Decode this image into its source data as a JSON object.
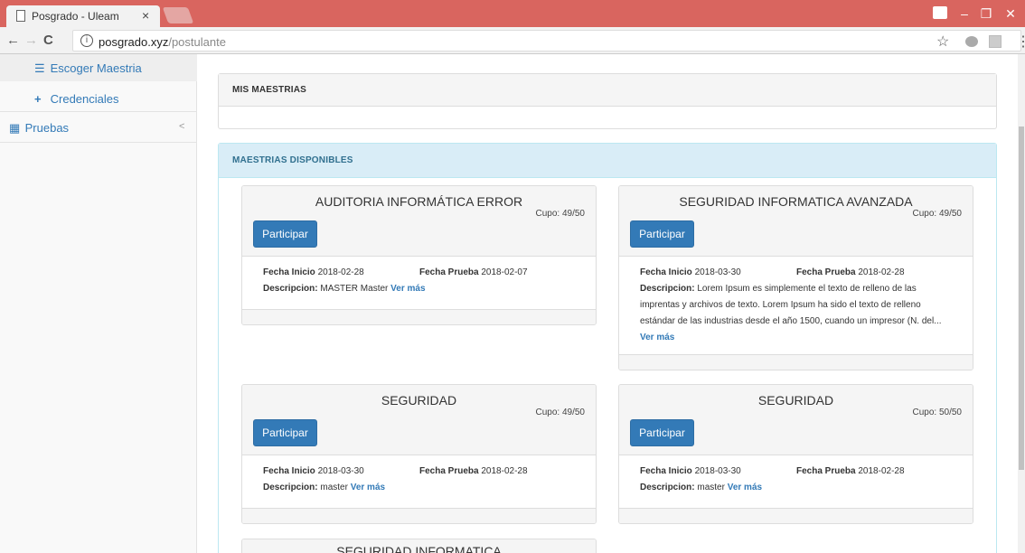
{
  "browser": {
    "tab_title": "Posgrado - Uleam",
    "tab_close": "×",
    "url_host": "posgrado.xyz",
    "url_path": "/postulante"
  },
  "sidebar": {
    "items": [
      {
        "label": "Escoger Maestria",
        "icon": "list-icon"
      },
      {
        "label": "Credenciales",
        "icon": "plus-icon"
      },
      {
        "label": "Pruebas",
        "icon": "film-icon"
      }
    ]
  },
  "mis_maestrias": {
    "heading": "MIS MAESTRIAS"
  },
  "disponibles": {
    "heading": "MAESTRIAS DISPONIBLES",
    "labels": {
      "cupo": "Cupo:",
      "participar": "Participar",
      "fecha_inicio": "Fecha Inicio",
      "fecha_prueba": "Fecha Prueba",
      "descripcion": "Descripcion:",
      "ver_mas": "Ver más"
    },
    "cards": [
      {
        "title": "AUDITORIA INFORMÁTICA ERROR",
        "cupo": "49/50",
        "fecha_inicio": "2018-02-28",
        "fecha_prueba": "2018-02-07",
        "descripcion": "MASTER Master"
      },
      {
        "title": "SEGURIDAD INFORMATICA AVANZADA",
        "cupo": "49/50",
        "fecha_inicio": "2018-03-30",
        "fecha_prueba": "2018-02-28",
        "descripcion": "Lorem Ipsum es simplemente el texto de relleno de las imprentas y archivos de texto. Lorem Ipsum ha sido el texto de relleno estándar de las industrias desde el año 1500, cuando un impresor (N. del..."
      },
      {
        "title": "SEGURIDAD",
        "cupo": "49/50",
        "fecha_inicio": "2018-03-30",
        "fecha_prueba": "2018-02-28",
        "descripcion": "master"
      },
      {
        "title": "SEGURIDAD",
        "cupo": "50/50",
        "fecha_inicio": "2018-03-30",
        "fecha_prueba": "2018-02-28",
        "descripcion": "master"
      },
      {
        "title": "SEGURIDAD INFORMATICA"
      }
    ]
  },
  "colors": {
    "titlebar": "#d9655f",
    "primary": "#337ab7",
    "info_bg": "#d9edf7",
    "info_text": "#31708f"
  }
}
